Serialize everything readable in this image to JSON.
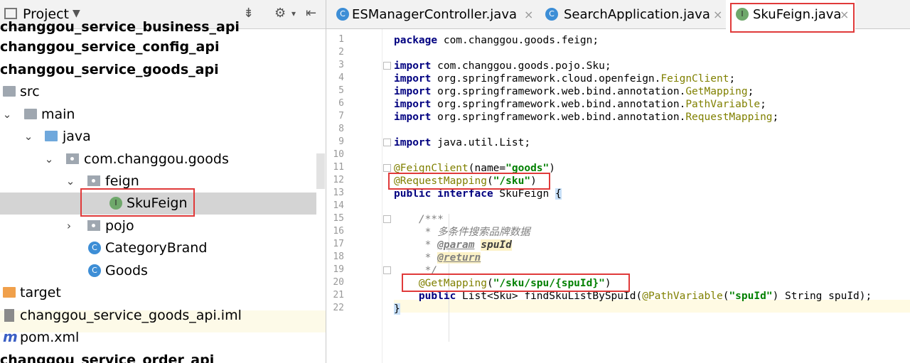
{
  "project_panel": {
    "title": "Project",
    "icons": [
      "chevron-down-icon",
      "collapse-icon",
      "gear-icon",
      "hide-icon"
    ],
    "tree": [
      {
        "label": "changgou_service_business_api",
        "bold": true,
        "depth": 0,
        "partial": true
      },
      {
        "label": "changgou_service_config_api",
        "bold": true,
        "depth": 0
      },
      {
        "label": "changgou_service_goods_api",
        "bold": true,
        "depth": 0
      },
      {
        "label": "src",
        "icon": "folder-icon",
        "depth": 0
      },
      {
        "label": "main",
        "icon": "folder-icon",
        "arrow": "down",
        "depth": 1
      },
      {
        "label": "java",
        "icon": "folder-icon",
        "arrow": "down",
        "depth": 2
      },
      {
        "label": "com.changgou.goods",
        "icon": "package-icon",
        "arrow": "down",
        "depth": 3
      },
      {
        "label": "feign",
        "icon": "package-icon",
        "arrow": "down",
        "depth": 4
      },
      {
        "label": "SkuFeign",
        "icon": "interface-icon",
        "depth": 5,
        "selected": true
      },
      {
        "label": "pojo",
        "icon": "package-icon",
        "arrow": "right",
        "depth": 4
      },
      {
        "label": "CategoryBrand",
        "icon": "class-icon",
        "depth": 5
      },
      {
        "label": "Goods",
        "icon": "class-icon",
        "depth": 5
      },
      {
        "label": "target",
        "icon": "folder-icon",
        "depth": 0
      },
      {
        "label": "changgou_service_goods_api.iml",
        "icon": "iml-file-icon",
        "depth": 0
      },
      {
        "label": "pom.xml",
        "icon": "maven-icon",
        "depth": 0
      },
      {
        "label": "changgou_service_order_api",
        "bold": true,
        "depth": 0,
        "partial": true
      }
    ]
  },
  "tabs": [
    {
      "label": "ESManagerController.java",
      "icon": "class-icon",
      "active": false
    },
    {
      "label": "SearchApplication.java",
      "icon": "class-icon",
      "active": false
    },
    {
      "label": "SkuFeign.java",
      "icon": "interface-icon",
      "active": true
    }
  ],
  "tab_close_glyph": "×",
  "editor": {
    "line_numbers": [
      "1",
      "2",
      "3",
      "4",
      "5",
      "6",
      "7",
      "8",
      "9",
      "10",
      "11",
      "12",
      "13",
      "14",
      "15",
      "16",
      "17",
      "18",
      "19",
      "20",
      "21",
      "22"
    ],
    "code": {
      "l1_kw": "package",
      "l1_rest": " com.changgou.goods.feign;",
      "l3_kw": "import",
      "l3_rest": " com.changgou.goods.pojo.Sku;",
      "l4_kw": "import",
      "l4_rest": " org.springframework.cloud.openfeign.",
      "l4_an": "FeignClient",
      "l4_end": ";",
      "l5_kw": "import",
      "l5_rest": " org.springframework.web.bind.annotation.",
      "l5_an": "GetMapping",
      "l5_end": ";",
      "l6_kw": "import",
      "l6_rest": " org.springframework.web.bind.annotation.",
      "l6_an": "PathVariable",
      "l6_end": ";",
      "l7_kw": "import",
      "l7_rest": " org.springframework.web.bind.annotation.",
      "l7_an": "RequestMapping",
      "l7_end": ";",
      "l9_kw": "import",
      "l9_rest": " java.util.List;",
      "l11_an": "@FeignClient",
      "l11_a": "(name=",
      "l11_str": "\"goods\"",
      "l11_b": ")",
      "l12_an": "@RequestMapping",
      "l12_a": "(",
      "l12_str": "\"/sku\"",
      "l12_b": ")",
      "l13_kw": "public interface",
      "l13_rest": " SkuFeign ",
      "l13_brace": "{",
      "l15_cm": "    /***",
      "l16_cm": "     * 多条件搜索品牌数据",
      "l17_cm": "     * ",
      "l17_tag": "@param",
      "l17_sp": " ",
      "l17_param": "spuId",
      "l18_cm": "     * ",
      "l18_tag": "@return",
      "l19_cm": "     */",
      "l20_pre": "    ",
      "l20_an": "@GetMapping",
      "l20_a": "(",
      "l20_str": "\"/sku/spu/{spuId}\"",
      "l20_b": ")",
      "l21_pre": "    ",
      "l21_kw": "public",
      "l21_a": " List<Sku> findSkuListBySpuId(",
      "l21_an": "@PathVariable",
      "l21_b": "(",
      "l21_str": "\"spuId\"",
      "l21_c": ") String spuId);",
      "l22_brace": "}"
    }
  },
  "colors": {
    "selection": "#d4d4d4",
    "highlight_box": "#e03a3a",
    "keyword": "#000080",
    "annotation": "#808000",
    "string": "#008000"
  }
}
